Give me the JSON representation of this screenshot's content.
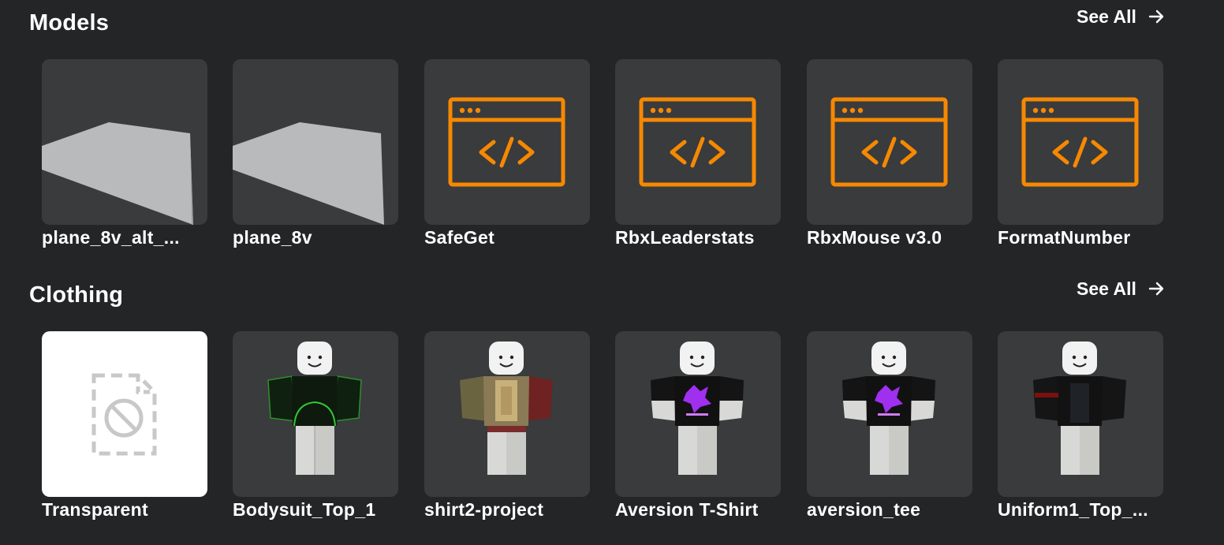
{
  "models": {
    "title": "Models",
    "see_all": "See All",
    "items": [
      {
        "name": "plane_8v_alt_...",
        "icon": "plane-mesh"
      },
      {
        "name": "plane_8v",
        "icon": "plane-mesh"
      },
      {
        "name": "SafeGet",
        "icon": "code-window-icon"
      },
      {
        "name": "RbxLeaderstats",
        "icon": "code-window-icon"
      },
      {
        "name": "RbxMouse v3.0",
        "icon": "code-window-icon"
      },
      {
        "name": "FormatNumber",
        "icon": "code-window-icon"
      }
    ]
  },
  "clothing": {
    "title": "Clothing",
    "see_all": "See All",
    "items": [
      {
        "name": "Transparent",
        "icon": "missing-file-icon"
      },
      {
        "name": "Bodysuit_Top_1",
        "icon": "avatar-shirt"
      },
      {
        "name": "shirt2-project",
        "icon": "avatar-shirt"
      },
      {
        "name": "Aversion T-Shirt",
        "icon": "avatar-shirt"
      },
      {
        "name": "aversion_tee",
        "icon": "avatar-shirt"
      },
      {
        "name": "Uniform1_Top_...",
        "icon": "avatar-shirt"
      }
    ]
  },
  "colors": {
    "background": "#232527",
    "card": "#393b3d",
    "code_icon": "#f68802",
    "accent_purple": "#a02ff0"
  }
}
